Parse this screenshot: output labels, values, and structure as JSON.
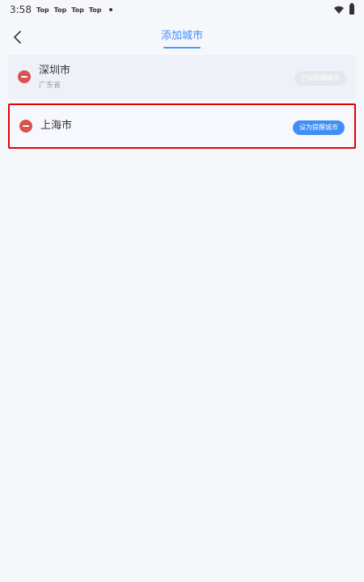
{
  "status_bar": {
    "time": "3:58",
    "notifications": [
      "Top",
      "Top",
      "Top",
      "Top"
    ],
    "icons": [
      "wifi-icon",
      "battery-icon"
    ]
  },
  "header": {
    "title": "添加城市",
    "back_icon": "chevron-left-icon",
    "accent_color": "#3b8dff"
  },
  "cities": [
    {
      "name": "深圳市",
      "province": "广东省",
      "action_label": "已设提醒城市",
      "action_state": "disabled"
    },
    {
      "name": "上海市",
      "province": "",
      "action_label": "设为提醒城市",
      "action_state": "enabled"
    }
  ],
  "colors": {
    "delete": "#d9534f",
    "primary_button": "#3f8ef7",
    "highlight_border": "#e00000"
  }
}
